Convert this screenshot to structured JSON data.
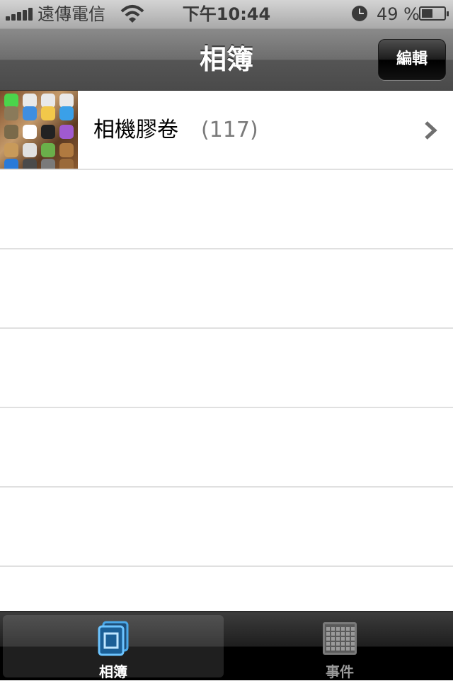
{
  "status_bar": {
    "carrier": "遠傳電信",
    "time": "下午10:44",
    "battery_percent": "49 %",
    "battery_level": 0.49,
    "icons": [
      "signal-icon",
      "wifi-icon",
      "alarm-clock-icon",
      "battery-icon"
    ]
  },
  "nav_bar": {
    "title": "相簿",
    "edit_label": "編輯"
  },
  "albums": [
    {
      "name": "相機膠卷",
      "count": "(117)"
    }
  ],
  "tab_bar": {
    "tabs": [
      {
        "label": "相簿",
        "icon": "albums-icon",
        "selected": true
      },
      {
        "label": "事件",
        "icon": "events-calendar-icon",
        "selected": false
      }
    ]
  },
  "colors": {
    "accent": "#4aa8e8",
    "count_gray": "#7a7a7a",
    "separator": "#e0e0e0"
  }
}
